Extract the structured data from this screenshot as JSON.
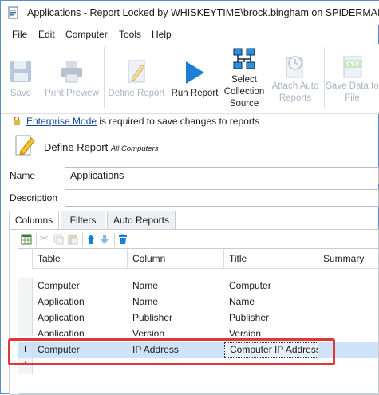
{
  "window": {
    "title": "Applications - Report Locked by WHISKEYTIME\\brock.bingham on SPIDERMAN"
  },
  "menu": [
    "File",
    "Edit",
    "Computer",
    "Tools",
    "Help"
  ],
  "ribbon": {
    "save": "Save",
    "print_preview": "Print Preview",
    "define_report": "Define Report",
    "run_report": "Run Report",
    "select_collection_source": [
      "Select",
      "Collection",
      "Source"
    ],
    "attach_auto_reports": [
      "Attach Auto",
      "Reports"
    ],
    "save_data_to_file": [
      "Save Data to",
      "File"
    ]
  },
  "notice": {
    "link": "Enterprise Mode",
    "text": " is required to save changes to reports"
  },
  "section": {
    "title": "Define Report",
    "subtitle": "All Computers"
  },
  "form": {
    "name_label": "Name",
    "name_value": "Applications",
    "description_label": "Description",
    "description_value": ""
  },
  "tabs": [
    "Columns",
    "Filters",
    "Auto Reports"
  ],
  "grid": {
    "headers": [
      "Table",
      "Column",
      "Title",
      "Summary"
    ],
    "rows": [
      [
        "Computer",
        "Name",
        "Computer",
        ""
      ],
      [
        "Application",
        "Name",
        "Name",
        ""
      ],
      [
        "Application",
        "Publisher",
        "Publisher",
        ""
      ],
      [
        "Application",
        "Version",
        "Version",
        ""
      ],
      [
        "Computer",
        "IP Address",
        "Computer IP Address",
        ""
      ]
    ],
    "editing_row_marker": "I",
    "new_row_marker": "*"
  }
}
